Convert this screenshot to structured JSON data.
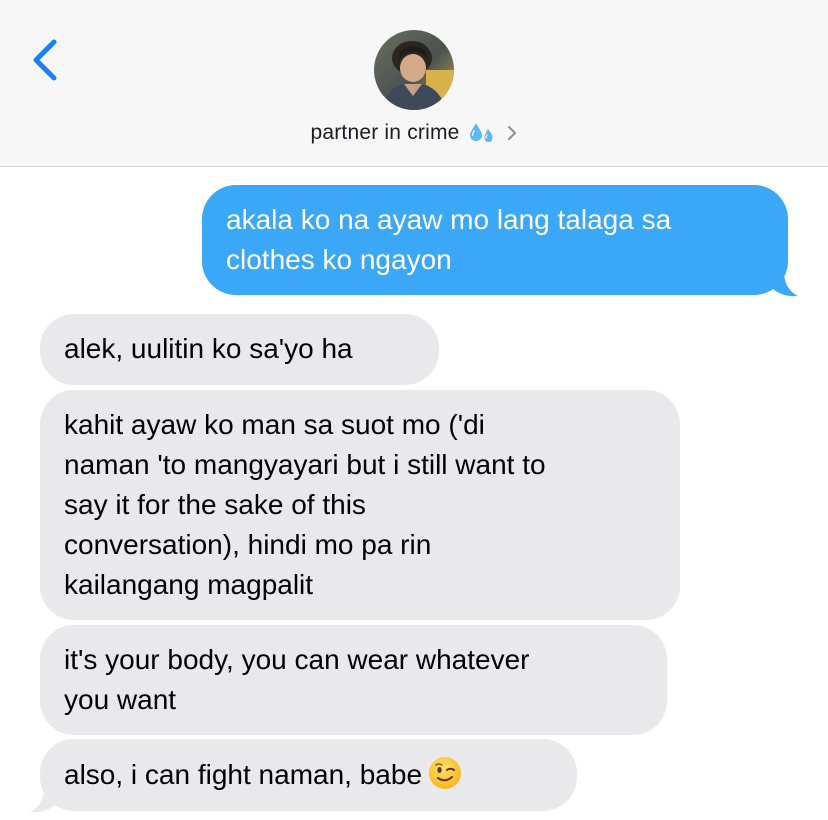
{
  "header": {
    "contact_name": "partner in crime",
    "contact_emoji": "sweat-droplets-icon"
  },
  "colors": {
    "header_bg": "#f7f7f7",
    "accent_blue": "#1a80f7",
    "outgoing_bubble": "#3aa8f7",
    "incoming_bubble": "#e9e9eb"
  },
  "messages": [
    {
      "direction": "outgoing",
      "lines": [
        "akala ko na ayaw mo lang talaga sa",
        "clothes ko ngayon"
      ]
    },
    {
      "direction": "incoming",
      "lines": [
        "alek, uulitin ko sa'yo ha"
      ]
    },
    {
      "direction": "incoming",
      "lines": [
        "kahit ayaw ko man sa suot mo ('di",
        "naman 'to mangyayari but i still want to",
        "say it for the sake of this",
        "conversation), hindi mo pa rin",
        "kailangang magpalit"
      ]
    },
    {
      "direction": "incoming",
      "lines": [
        "it's your body, you can wear whatever",
        "you want"
      ]
    },
    {
      "direction": "incoming",
      "lines": [
        "also, i can fight naman, babe"
      ],
      "emoji": "winking-face-icon"
    }
  ]
}
